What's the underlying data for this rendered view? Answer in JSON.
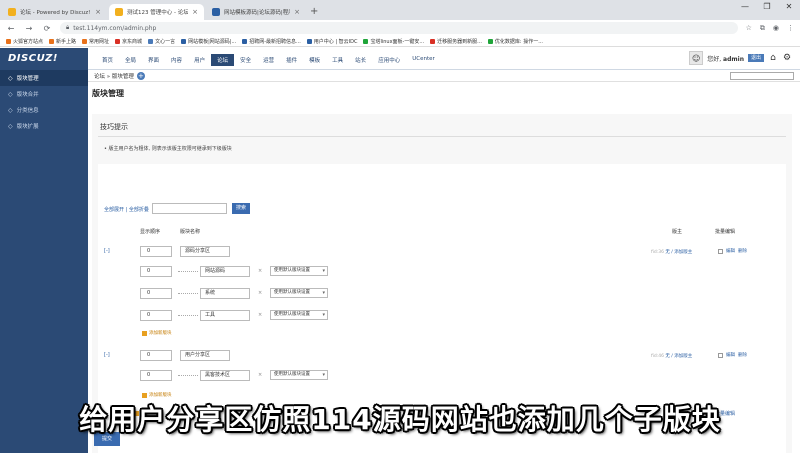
{
  "browser": {
    "tabs": [
      {
        "label": "论坛 - Powered by Discuz!",
        "color": "#f2b01e",
        "active": false
      },
      {
        "label": "测试123 管理中心 - 论坛 - 超级...",
        "color": "#f2b01e",
        "active": true
      },
      {
        "label": "网站模板源码|论坛源码|程序源码|...",
        "color": "#2b5fa3",
        "active": false
      }
    ],
    "new_tab": "+",
    "window_controls": [
      "—",
      "❐",
      "✕"
    ],
    "nav": {
      "back": "←",
      "forward": "→",
      "reload": "⟳"
    },
    "address": "test.114ym.com/admin.php",
    "bookmarks": [
      {
        "label": "火狐官方站点",
        "color": "#e8711a"
      },
      {
        "label": "新手上路",
        "color": "#e8711a"
      },
      {
        "label": "常用网址",
        "color": "#e8711a"
      },
      {
        "label": "京东商城",
        "color": "#d93025"
      },
      {
        "label": "文心一言",
        "color": "#4a7ab8"
      },
      {
        "label": "网站模板|网站源码|...",
        "color": "#2b5fa3"
      },
      {
        "label": "招聘网-最新招聘信息...",
        "color": "#2b5fa3"
      },
      {
        "label": "用户中心 | 智云IDC",
        "color": "#2b5fa3"
      },
      {
        "label": "宝塔linux面板-一键安...",
        "color": "#20a53a"
      },
      {
        "label": "迁移服务器到新服...",
        "color": "#d93025"
      },
      {
        "label": "优化数据库: 操作一...",
        "color": "#20a53a"
      }
    ]
  },
  "header": {
    "logo": "DISCUZ!",
    "nav": [
      "首页",
      "全局",
      "界面",
      "内容",
      "用户",
      "论坛",
      "安全",
      "运营",
      "插件",
      "模板",
      "工具",
      "站长",
      "应用中心",
      "UCenter"
    ],
    "active_nav": 5,
    "greeting_prefix": "您好,",
    "username": "admin",
    "logout": "退出"
  },
  "sidebar": {
    "items": [
      {
        "label": "版块管理",
        "active": true
      },
      {
        "label": "版块合并",
        "active": false
      },
      {
        "label": "分类信息",
        "active": false
      },
      {
        "label": "版块扩展",
        "active": false
      }
    ]
  },
  "breadcrumb": {
    "text": "论坛 » 版块管理",
    "plus": "+"
  },
  "page": {
    "title": "版块管理",
    "tips_title": "技巧提示",
    "tips_body": "•  版主用户名为粗体, 则表示该版主权限可继承到下级版块",
    "expand_all": "全部展开",
    "collapse_all": "全部折叠",
    "search_button": "搜索",
    "columns": {
      "order": "显示顺序",
      "name": "版块名称",
      "moderator": "版主",
      "batch": "批量编辑"
    },
    "groups": [
      {
        "toggle": "[-]",
        "order": "0",
        "name": "源码分享区",
        "forums": [
          {
            "order": "0",
            "name": "网站源码",
            "template": "使用默认版块设置"
          },
          {
            "order": "0",
            "name": "系统",
            "template": "使用默认版块设置"
          },
          {
            "order": "0",
            "name": "工具",
            "template": "使用默认版块设置"
          }
        ],
        "add_forum": "添加新版块",
        "moderator_prefix": "fid:36",
        "moderator": "无 / 添加版主",
        "ops": [
          "编辑",
          "删除"
        ]
      },
      {
        "toggle": "[-]",
        "order": "0",
        "name": "用户分享区",
        "forums": [
          {
            "order": "0",
            "name": "黑客技术区",
            "template": "使用默认版块设置"
          }
        ],
        "add_forum": "添加新版块",
        "moderator_prefix": "fid:46",
        "moderator": "无 / 添加版主",
        "ops": [
          "编辑",
          "删除"
        ]
      }
    ],
    "add_category": "添加新分区",
    "batch_bottom": "批量编辑",
    "submit": "提交"
  },
  "caption": "给用户分享区仿照114源码网站也添加几个子版块"
}
